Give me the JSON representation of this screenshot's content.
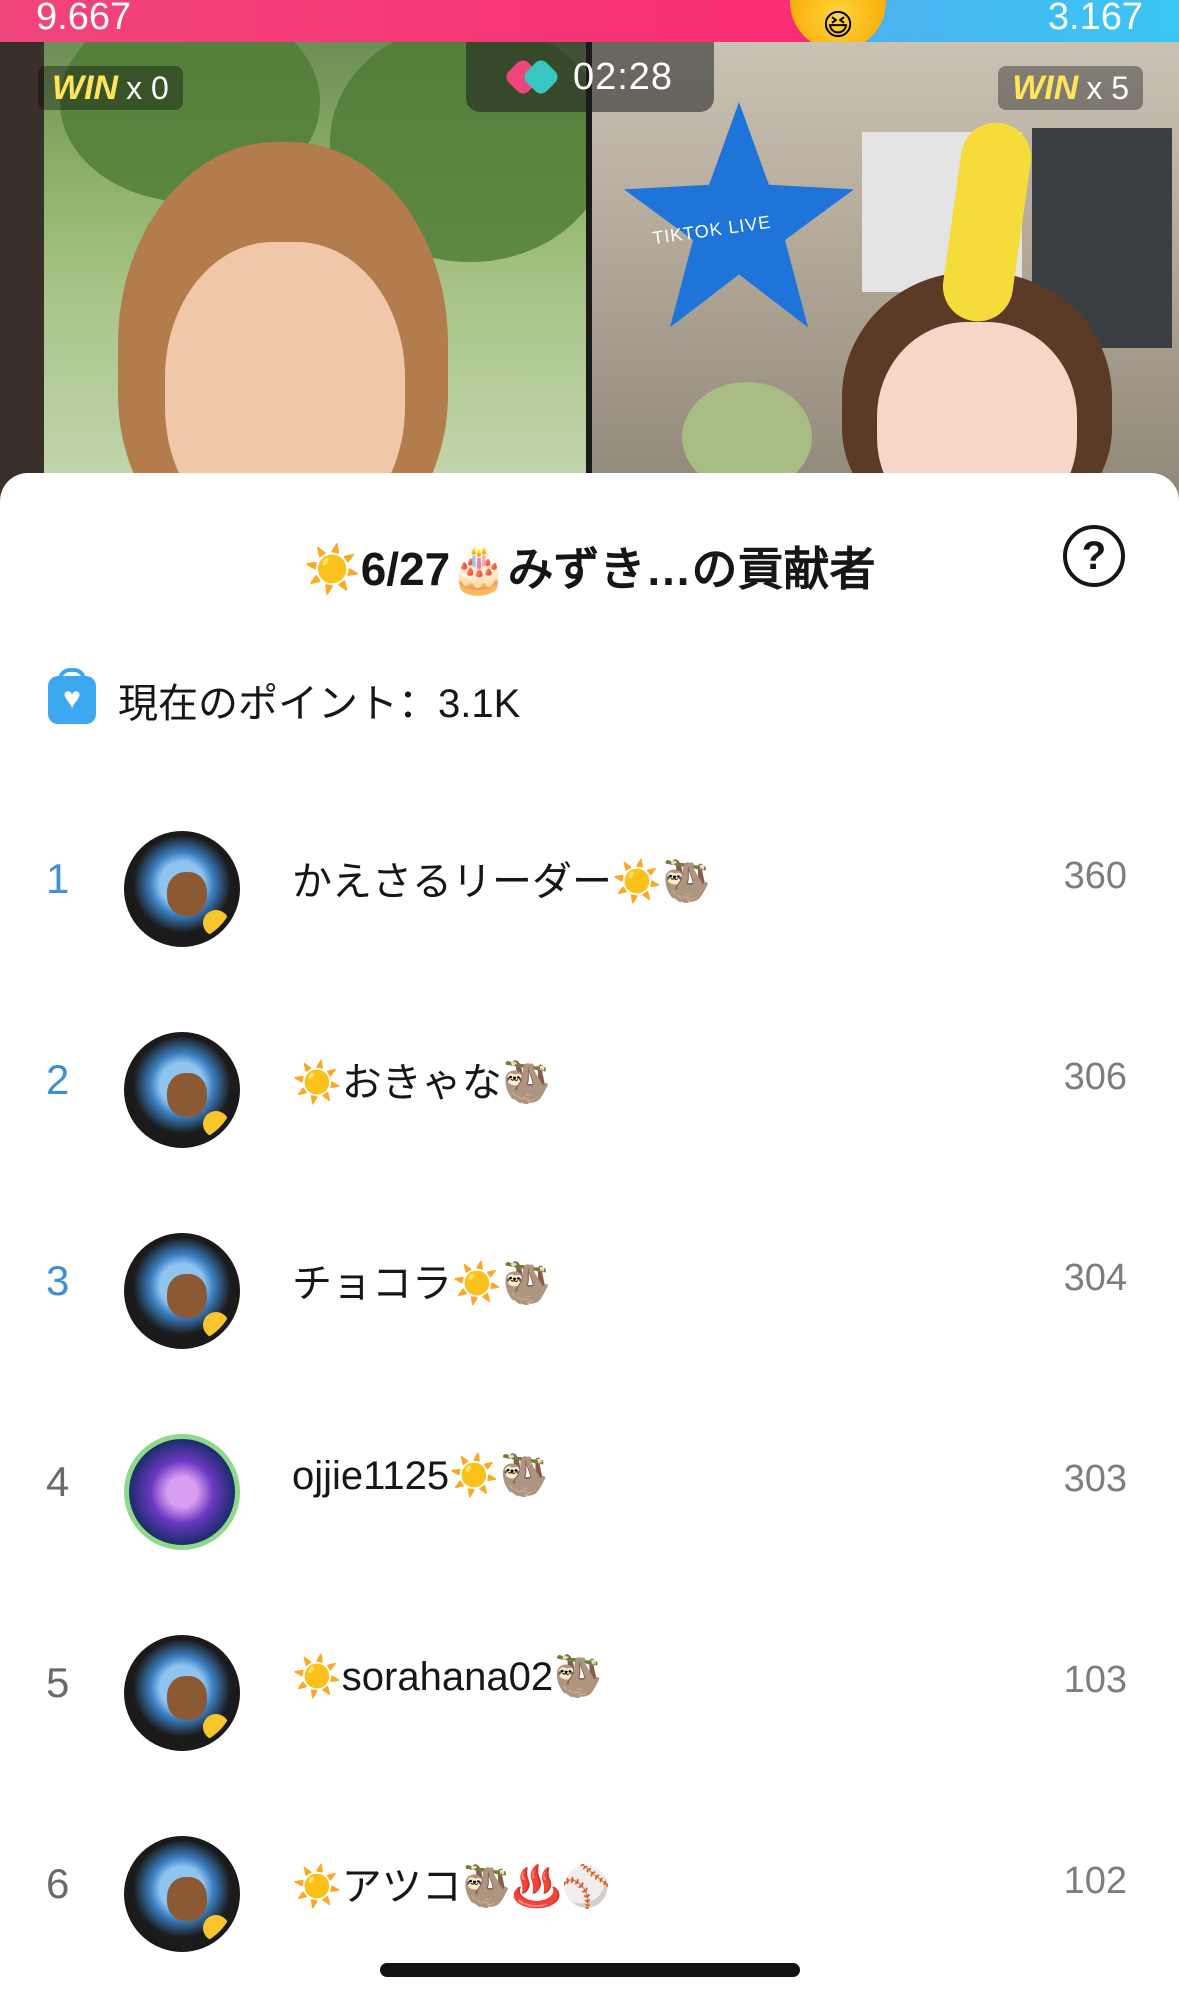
{
  "battle": {
    "left_score": "9.667",
    "right_score": "3.167",
    "timer": "02:28",
    "left_win_label": "WIN",
    "left_win_count": "x 0",
    "right_win_label": "WIN",
    "right_win_count": "x 5",
    "colors": {
      "left": "#fb2c73",
      "right": "#38c6f5"
    },
    "star_text": "TIKTOK LIVE"
  },
  "sheet": {
    "title": "☀️6/27🎂みずき…の貢献者",
    "help_icon": "?",
    "points_label": "現在のポイント：3.1K"
  },
  "contributors": [
    {
      "rank": "1",
      "name": "かえさるリーダー☀️🦥",
      "score": "360",
      "avatar": "sloth-heart-avatar"
    },
    {
      "rank": "2",
      "name": "☀️おきゃな🦥",
      "score": "306",
      "avatar": "sloth-heart-avatar"
    },
    {
      "rank": "3",
      "name": "チョコラ☀️🦥",
      "score": "304",
      "avatar": "sloth-heart-avatar"
    },
    {
      "rank": "4",
      "name": "ojjie1125☀️🦥",
      "score": "303",
      "avatar": "orca-avatar"
    },
    {
      "rank": "5",
      "name": "☀️sorahana02🦥",
      "score": "103",
      "avatar": "sloth-heart-avatar"
    },
    {
      "rank": "6",
      "name": "☀️アツコ🦥♨️⚾️",
      "score": "102",
      "avatar": "sloth-heart-avatar"
    }
  ],
  "accent_color": "#3f8fd6"
}
